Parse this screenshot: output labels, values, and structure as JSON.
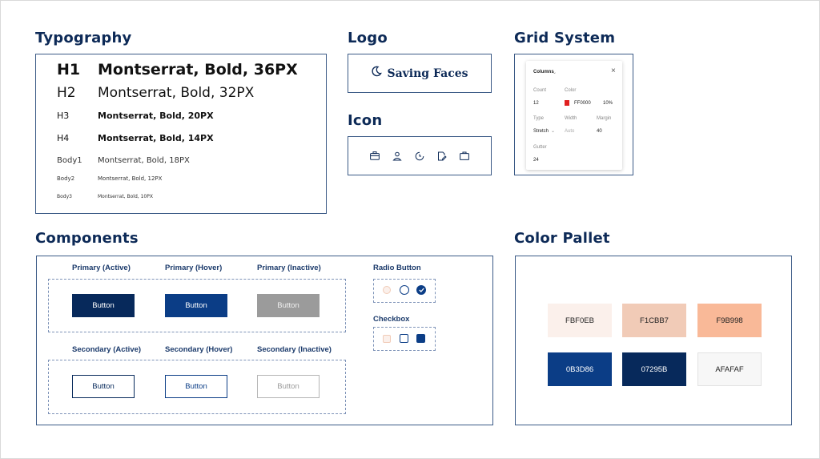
{
  "typography": {
    "title": "Typography",
    "rows": [
      {
        "tag": "H1",
        "sample": "Montserrat, Bold, 36PX"
      },
      {
        "tag": "H2",
        "sample": "Montserrat, Bold, 32PX"
      },
      {
        "tag": "H3",
        "sample": "Montserrat, Bold, 20PX"
      },
      {
        "tag": "H4",
        "sample": "Montserrat, Bold, 14PX"
      },
      {
        "tag": "Body1",
        "sample": "Montserrat, Bold, 18PX"
      },
      {
        "tag": "Body2",
        "sample": "Montserrat, Bold, 12PX"
      },
      {
        "tag": "Body3",
        "sample": "Montserrat, Bold, 10PX"
      }
    ]
  },
  "logo": {
    "title": "Logo",
    "brand": "Saving Faces",
    "icon": "moon-icon"
  },
  "icon": {
    "title": "Icon",
    "icons": [
      "briefcase-icon",
      "user-icon",
      "clock-icon",
      "document-edit-icon",
      "bag-icon"
    ]
  },
  "grid": {
    "title": "Grid System",
    "panel_title": "Columns",
    "count_label": "Count",
    "count_value": "12",
    "color_label": "Color",
    "color_hex": "FF0000",
    "color_opacity": "10%",
    "color_swatch": "#e02020",
    "type_label": "Type",
    "type_value": "Stretch",
    "width_label": "Width",
    "width_value": "Auto",
    "margin_label": "Margin",
    "margin_value": "40",
    "gutter_label": "Gutter",
    "gutter_value": "24"
  },
  "components": {
    "title": "Components",
    "primary": [
      {
        "label": "Primary (Active)",
        "button": "Button",
        "bg": "#07295B"
      },
      {
        "label": "Primary (Hover)",
        "button": "Button",
        "bg": "#0B3D86"
      },
      {
        "label": "Primary (Inactive)",
        "button": "Button",
        "bg": "#9B9B9B"
      }
    ],
    "secondary": [
      {
        "label": "Secondary (Active)",
        "button": "Button"
      },
      {
        "label": "Secondary (Hover)",
        "button": "Button"
      },
      {
        "label": "Secondary (Inactive)",
        "button": "Button"
      }
    ],
    "radio_label": "Radio Button",
    "checkbox_label": "Checkbox"
  },
  "palette": {
    "title": "Color Pallet",
    "colors": [
      {
        "name": "FBF0EB",
        "hex": "#FBF0EB"
      },
      {
        "name": "F1CBB7",
        "hex": "#F1CBB7"
      },
      {
        "name": "F9B998",
        "hex": "#F9B998"
      },
      {
        "name": "0B3D86",
        "hex": "#0B3D86"
      },
      {
        "name": "07295B",
        "hex": "#07295B"
      },
      {
        "name": "AFAFAF",
        "hex": "#F7F7F7"
      }
    ]
  }
}
